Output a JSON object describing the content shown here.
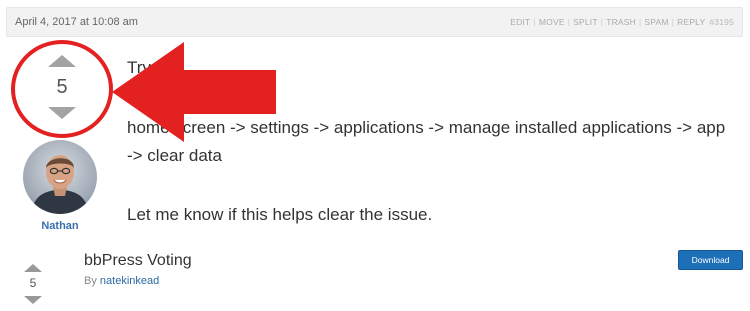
{
  "reply": {
    "date": "April 4, 2017 at 10:08 am",
    "admin_links": [
      "EDIT",
      "MOVE",
      "SPLIT",
      "TRASH",
      "SPAM",
      "REPLY"
    ],
    "reply_id": "#3195",
    "vote": {
      "score": "5"
    },
    "author": {
      "name": "Nathan"
    },
    "content": {
      "partial": "Try",
      "steps": "home screen -> settings -> applications -> manage installed applications -> app -> clear data",
      "closing": "Let me know if this helps clear the issue."
    }
  },
  "annotation": {
    "color": "#e32120"
  },
  "plugin": {
    "name": "bbPress Voting",
    "by_label": "By",
    "author": "natekinkead",
    "download_label": "Download",
    "vote": {
      "score": "5"
    }
  },
  "colors": {
    "accent": "#1d6fb8",
    "link": "#3a6fb0",
    "arrow": "#e32120"
  }
}
